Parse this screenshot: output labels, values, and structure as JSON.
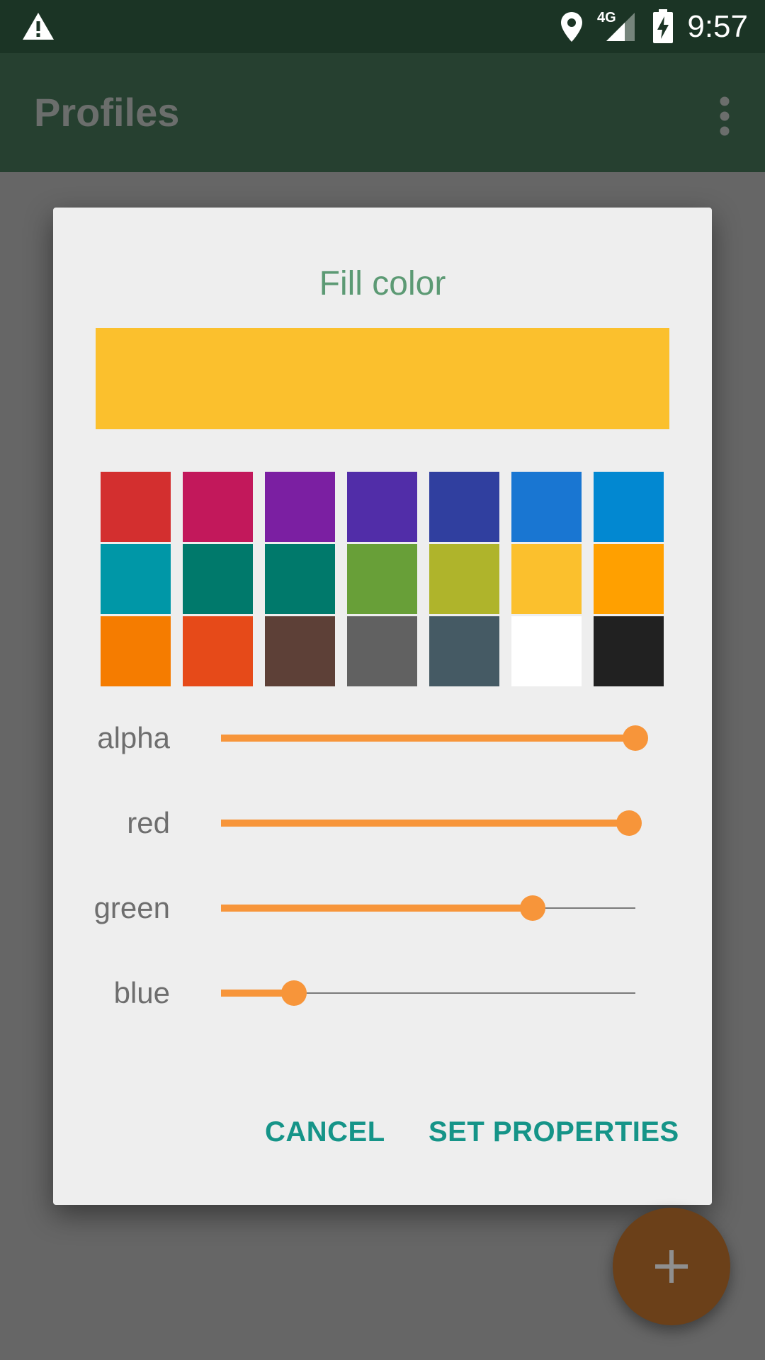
{
  "status_bar": {
    "time": "9:57",
    "network_label": "4G",
    "icons": [
      "warning-icon",
      "location-pin-icon",
      "signal-icon",
      "battery-charging-icon"
    ]
  },
  "app_bar": {
    "title": "Profiles",
    "overflow_icon": "more-vert-icon"
  },
  "dialog": {
    "title": "Fill color",
    "preview_color": "#fbc02d",
    "palette": [
      "#d32f2f",
      "#c2185b",
      "#7b1fa2",
      "#512da8",
      "#303f9f",
      "#1976d2",
      "#0288d1",
      "#0097a7",
      "#00796b",
      "#00796b",
      "#689f38",
      "#afb42b",
      "#fbc02d",
      "#ffa000",
      "#f57c00",
      "#e64a19",
      "#5d4037",
      "#616161",
      "#455a64",
      "#ffffff",
      "#212121"
    ],
    "sliders": [
      {
        "label": "alpha",
        "value": 255,
        "max": 255
      },
      {
        "label": "red",
        "value": 251,
        "max": 255
      },
      {
        "label": "green",
        "value": 192,
        "max": 255
      },
      {
        "label": "blue",
        "value": 45,
        "max": 255
      }
    ],
    "cancel_label": "CANCEL",
    "confirm_label": "SET PROPERTIES"
  },
  "fab": {
    "icon": "plus-icon"
  },
  "colors": {
    "status_bar": "#1b3425",
    "app_bar": "#264030",
    "scrim": "#666666",
    "dialog_bg": "#eeeeee",
    "accent": "#f7953a",
    "title_text": "#5c9a74",
    "button_text": "#159488",
    "fab": "#6b4019"
  }
}
